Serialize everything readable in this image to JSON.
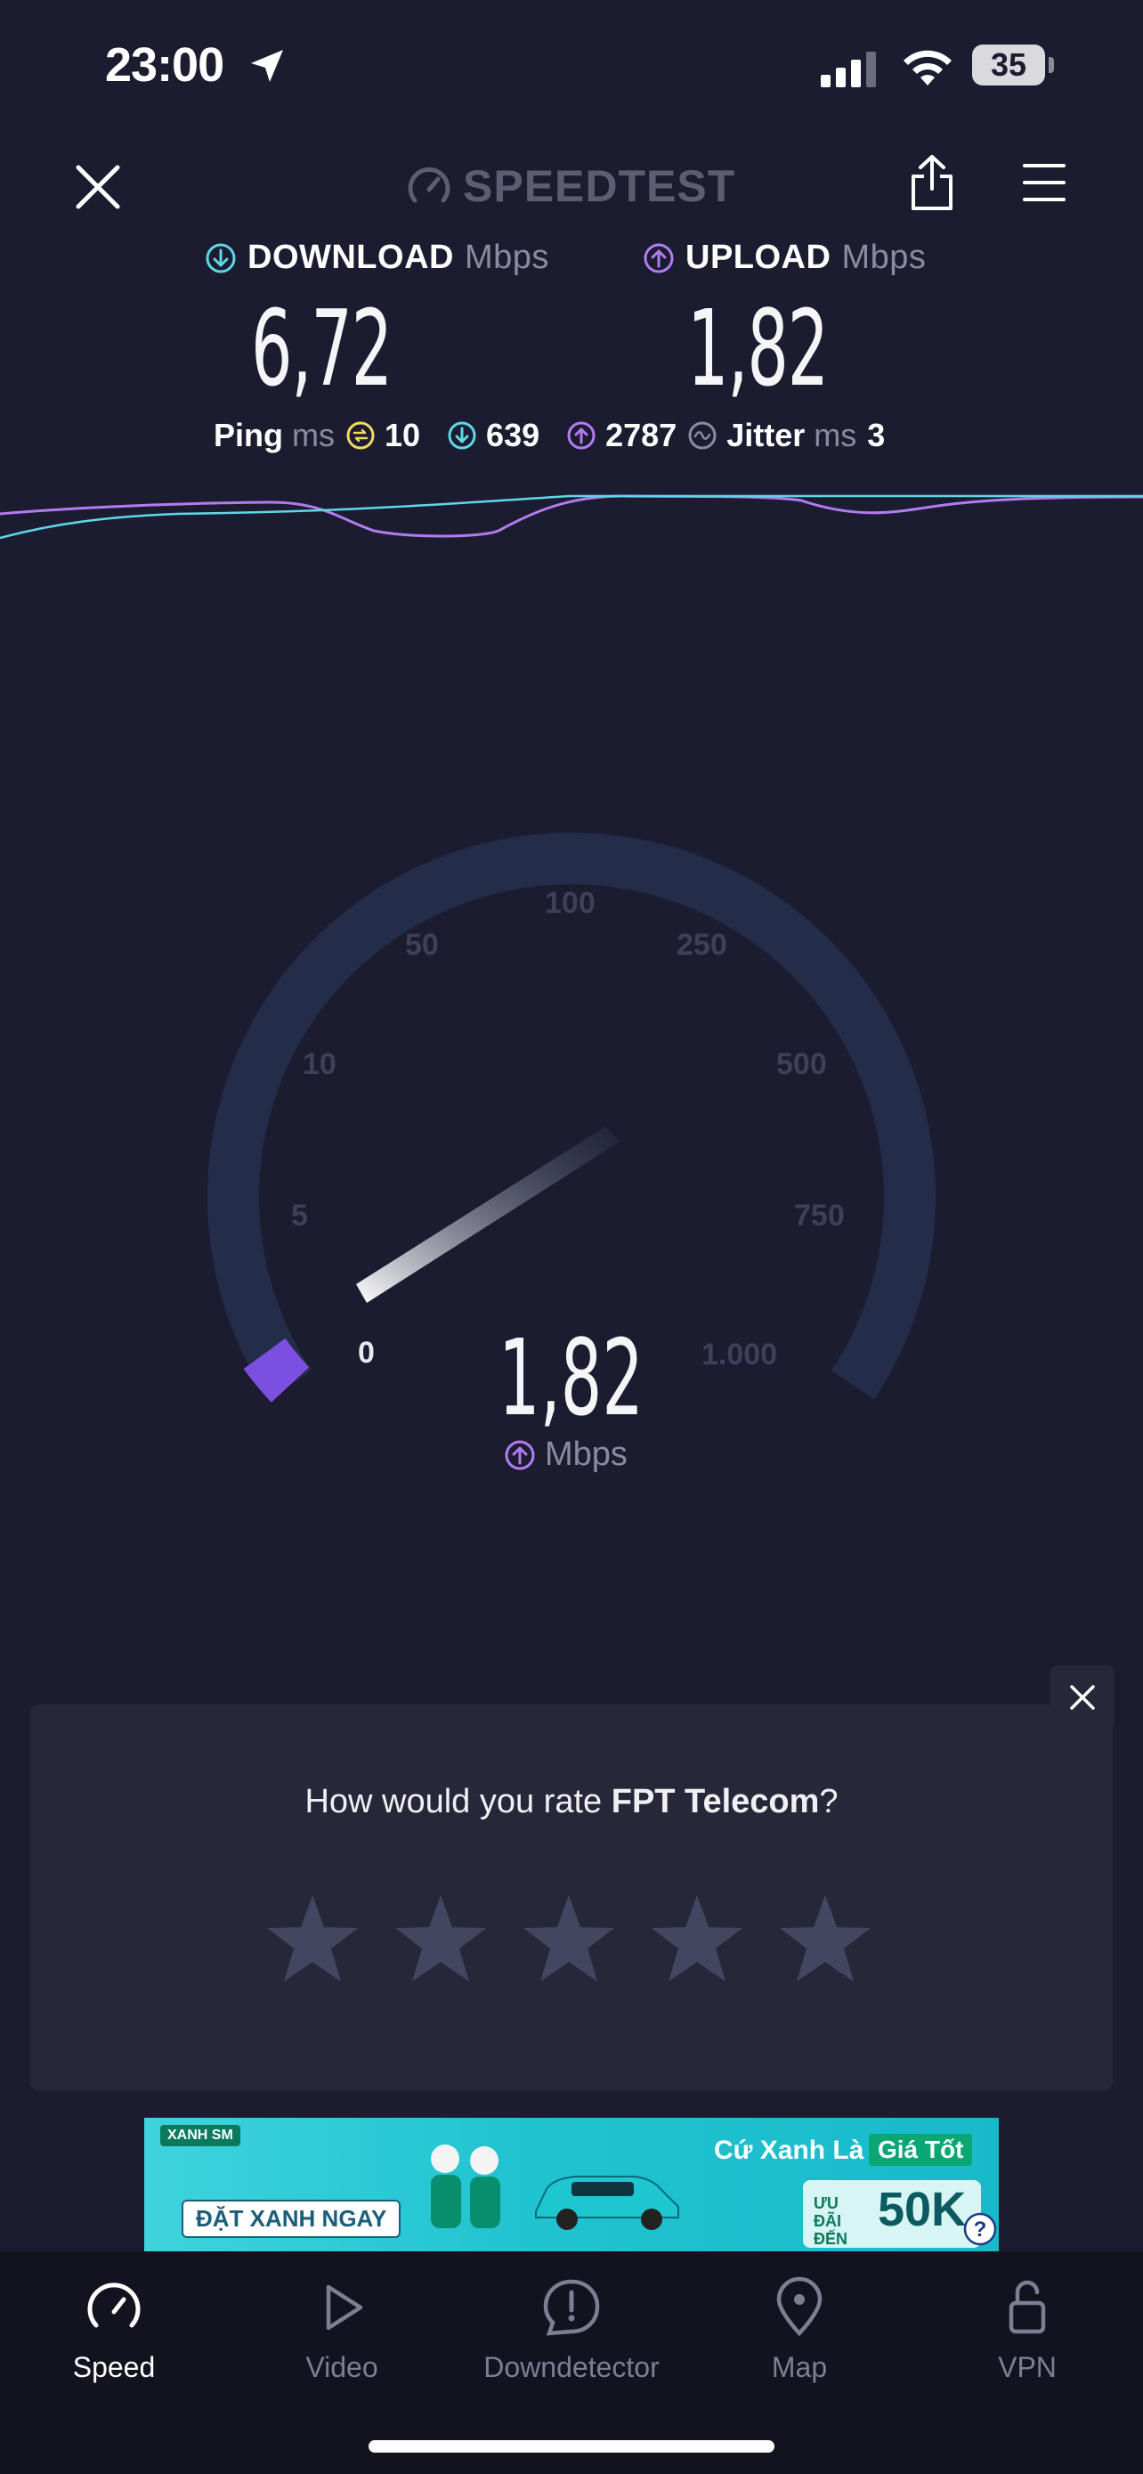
{
  "status_bar": {
    "time": "23:00",
    "battery": "35"
  },
  "header": {
    "logo": "SPEEDTEST"
  },
  "results": {
    "download_label": "DOWNLOAD",
    "download_unit": "Mbps",
    "download_value": "6,72",
    "upload_label": "UPLOAD",
    "upload_unit": "Mbps",
    "upload_value": "1,82",
    "ping_label": "Ping",
    "ping_unit": "ms",
    "ping_idle": "10",
    "ping_download": "639",
    "ping_upload": "2787",
    "jitter_label": "Jitter",
    "jitter_unit": "ms",
    "jitter_value": "3"
  },
  "gauge": {
    "ticks": [
      "0",
      "5",
      "10",
      "50",
      "100",
      "250",
      "500",
      "750",
      "1.000"
    ],
    "value": "1,82",
    "unit": "Mbps"
  },
  "rating": {
    "prompt_prefix": "How would you rate ",
    "provider": "FPT Telecom",
    "prompt_suffix": "?",
    "stars": 5
  },
  "ad": {
    "brand": "XANH SM",
    "cta": "ĐẶT XANH NGAY",
    "slogan": "Cứ Xanh Là",
    "slogan_highlight": "Giá Tốt",
    "deal_label": "ƯU ĐÃI ĐẾN",
    "deal_value": "50K"
  },
  "tabs": [
    {
      "label": "Speed",
      "icon": "speedometer-icon",
      "active": true
    },
    {
      "label": "Video",
      "icon": "play-icon",
      "active": false
    },
    {
      "label": "Downdetector",
      "icon": "alert-icon",
      "active": false
    },
    {
      "label": "Map",
      "icon": "map-pin-icon",
      "active": false
    },
    {
      "label": "VPN",
      "icon": "unlock-icon",
      "active": false
    }
  ],
  "colors": {
    "background": "#1c1c30",
    "download_accent": "#5fd8e6",
    "upload_accent": "#b27cf0",
    "ping_accent": "#f0dc5a",
    "gauge_track": "#232c48",
    "gauge_active": "#7b4fe0"
  }
}
